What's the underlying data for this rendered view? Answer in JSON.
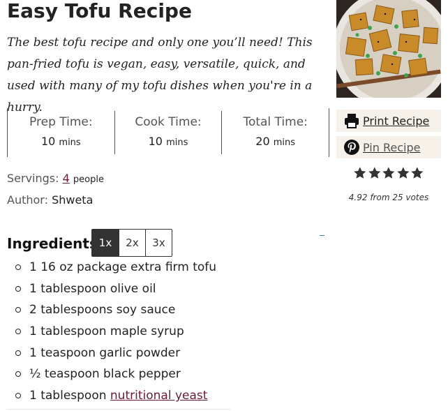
{
  "recipe": {
    "title": "Easy Tofu Recipe",
    "summary": "The best tofu recipe and only one you’ll need! This pan-fried tofu is vegan, easy, versatile, quick, and used with many of my tofu dishes when you're in a hurry."
  },
  "times": [
    {
      "label": "Prep Time:",
      "value": "10",
      "unit": "mins"
    },
    {
      "label": "Cook Time:",
      "value": "10",
      "unit": "mins"
    },
    {
      "label": "Total Time:",
      "value": "20",
      "unit": "mins"
    }
  ],
  "buttons": {
    "print_label": "Print Recipe",
    "pin_label": "Pin Recipe",
    "print_icon": "printer-icon",
    "pin_icon": "pinterest-icon"
  },
  "rating": {
    "stars": 5,
    "text": "4.92 from 25 votes"
  },
  "servings": {
    "label": "Servings:",
    "count": "4",
    "unit": "people"
  },
  "author": {
    "label": "Author:",
    "name": "Shweta"
  },
  "ingredients": {
    "heading": "Ingredients",
    "scale_options": [
      "1x",
      "2x",
      "3x"
    ],
    "selected_scale": "1x",
    "items": [
      {
        "text": "1 16 oz package extra firm tofu"
      },
      {
        "text": "1 tablespoon olive oil"
      },
      {
        "text": "2 tablespoons soy sauce"
      },
      {
        "text": "1 tablespoon maple syrup"
      },
      {
        "text": "1 teaspoon garlic powder"
      },
      {
        "text": "½ teaspoon black pepper"
      },
      {
        "text": "1 tablespoon ",
        "link": "nutritional yeast"
      }
    ]
  },
  "colors": {
    "accent_link": "#6a1b36",
    "button_bg": "#f6f2ea",
    "active_scale": "#333333"
  }
}
